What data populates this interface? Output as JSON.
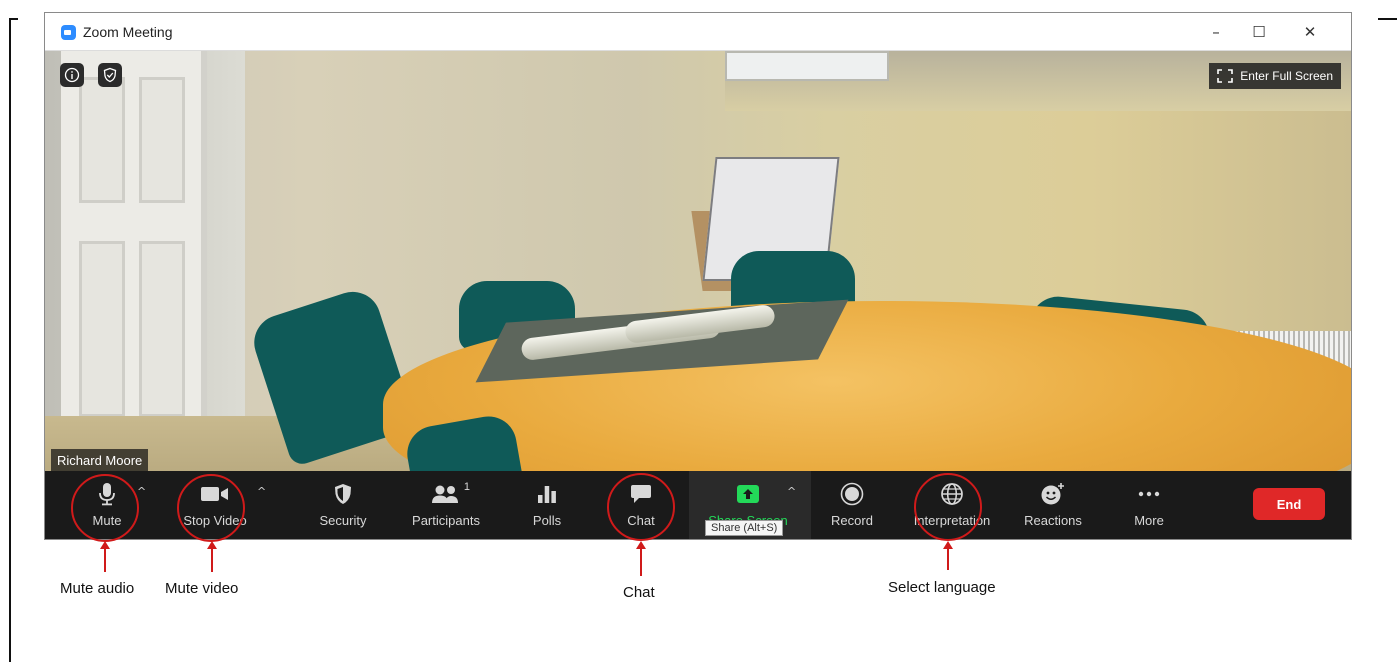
{
  "window": {
    "title": "Zoom Meeting",
    "controls": {
      "minimize": "–",
      "maximize": "☐",
      "close": "✕"
    }
  },
  "video": {
    "fullscreen_label": "Enter Full Screen",
    "participant_name": "Richard Moore"
  },
  "toolbar": {
    "mute": "Mute",
    "stop_video": "Stop Video",
    "security": "Security",
    "participants": "Participants",
    "participants_count": "1",
    "polls": "Polls",
    "chat": "Chat",
    "share_screen": "Share Screen",
    "record": "Record",
    "interpretation": "Interpretation",
    "reactions": "Reactions",
    "more": "More",
    "end": "End",
    "tooltip": "Share (Alt+S)"
  },
  "annotations": {
    "mute_audio": "Mute audio",
    "mute_video": "Mute video",
    "chat": "Chat",
    "select_language": "Select language"
  },
  "colors": {
    "toolbar_bg": "#1a1a1a",
    "share_green": "#23d959",
    "end_red": "#e02828",
    "annotation_red": "#d01a1a",
    "zoom_blue": "#2d8cff"
  }
}
